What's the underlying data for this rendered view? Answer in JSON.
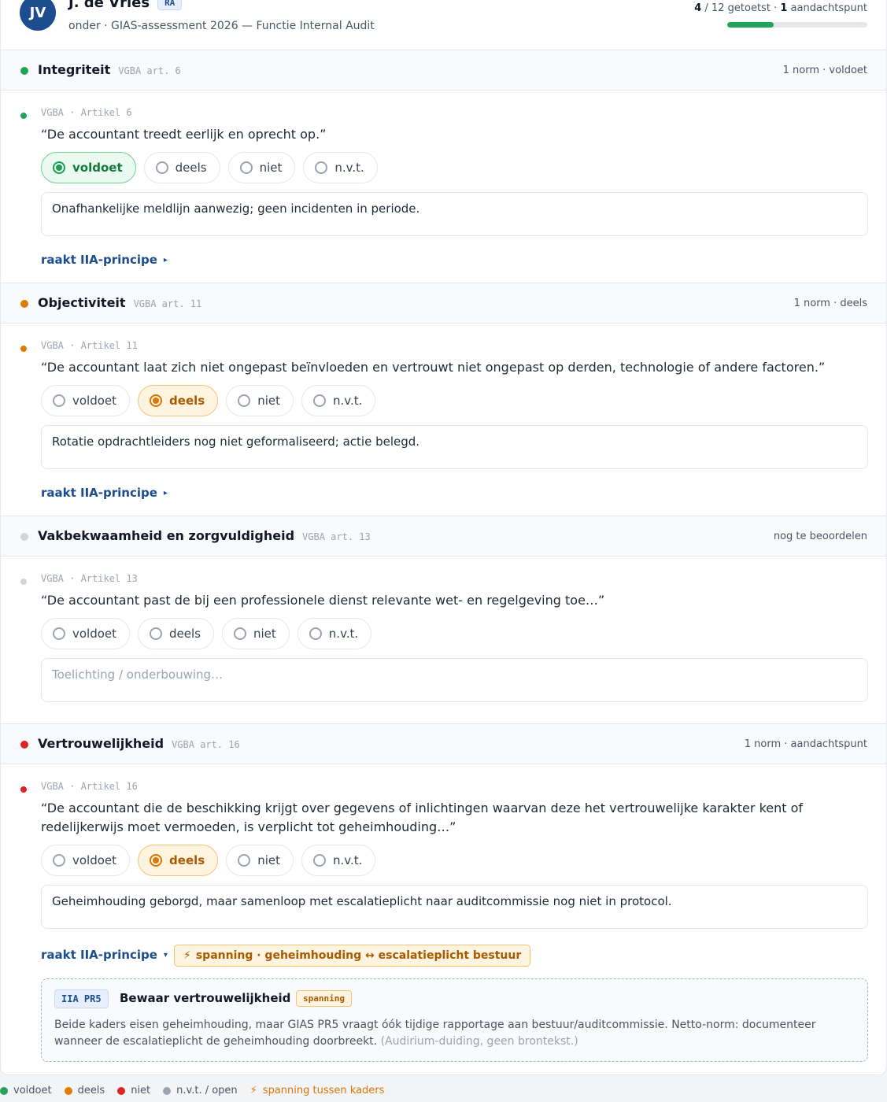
{
  "header": {
    "initials": "JV",
    "name": "J. de Vries",
    "role_badge": "RA",
    "subtitle": "onder · GIAS-assessment 2026 — Functie Internal Audit",
    "tested_count": "4",
    "tested_rest": "/ 12 getoetst ·",
    "attention_count": "1",
    "attention_label": "aandachtspunt",
    "progress_fraction": 0.33
  },
  "options": {
    "voldoet": "voldoet",
    "deels": "deels",
    "niet": "niet",
    "nvt": "n.v.t."
  },
  "link_label": "raakt IIA-principe",
  "sections": [
    {
      "title": "Integriteit",
      "ref": "VGBA art. 6",
      "status": "1 norm · voldoet",
      "color": "#22a35a",
      "norm_ref": "VGBA · Artikel 6",
      "quote": "“De accountant treedt eerlijk en oprecht op.”",
      "selected": "voldoet",
      "note": "Onafhankelijke meldlijn aanwezig; geen incidenten in periode."
    },
    {
      "title": "Objectiviteit",
      "ref": "VGBA art. 11",
      "status": "1 norm · deels",
      "color": "#e07b00",
      "norm_ref": "VGBA · Artikel 11",
      "quote": "“De accountant laat zich niet ongepast beïnvloeden en vertrouwt niet ongepast op derden, technologie of andere factoren.”",
      "selected": "deels",
      "note": "Rotatie opdrachtleiders nog niet geformaliseerd; actie belegd."
    },
    {
      "title": "Vakbekwaamheid en zorgvuldigheid",
      "ref": "VGBA art. 13",
      "status": "nog te beoordelen",
      "color": "#d1d5db",
      "norm_ref": "VGBA · Artikel 13",
      "quote": "“De accountant past de bij een professionele dienst relevante wet- en regelgeving toe…”",
      "selected": "",
      "note_placeholder": "Toelichting / onderbouwing…"
    },
    {
      "title": "Vertrouwelijkheid",
      "ref": "VGBA art. 16",
      "status": "1 norm · aandachtspunt",
      "color": "#dc2626",
      "norm_ref": "VGBA · Artikel 16",
      "quote": "“De accountant die de beschikking krijgt over gegevens of inlichtingen waarvan deze het vertrouwelijke karakter kent of redelijkerwijs moet vermoeden, is verplicht tot geheimhouding…”",
      "selected": "deels",
      "note": "Geheimhouding geborgd, maar samenloop met escalatieplicht naar auditcommissie nog niet in protocol.",
      "tension": "spanning · geheimhouding ↔ escalatieplicht bestuur",
      "principle": {
        "code": "IIA PR5",
        "title": "Bewaar vertrouwelijkheid",
        "tag": "spanning",
        "text": "Beide kaders eisen geheimhouding, maar GIAS PR5 vraagt óók tijdige rapportage aan bestuur/auditcommissie. Netto-norm: documenteer wanneer de escalatieplicht de geheimhouding doorbreekt.",
        "aside": "(Audirium-duiding, geen brontekst.)"
      }
    }
  ],
  "legend": {
    "voldoet": "voldoet",
    "deels": "deels",
    "niet": "niet",
    "nvt": "n.v.t. / open",
    "spanning": "spanning tussen kaders"
  }
}
